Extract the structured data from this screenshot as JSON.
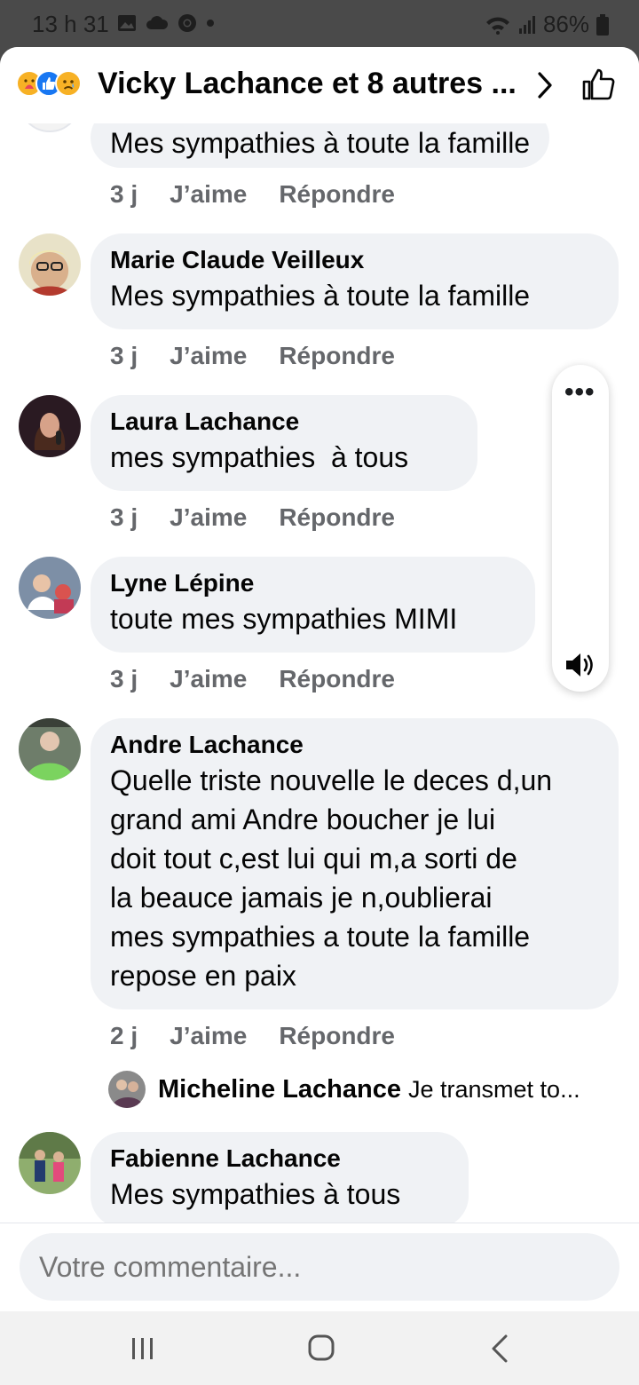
{
  "status_bar": {
    "time": "13 h 31",
    "battery": "86%"
  },
  "header": {
    "title": "Vicky Lachance et 8 autres ...",
    "reaction_icons": [
      "care-reaction-icon",
      "like-reaction-icon",
      "sad-reaction-icon"
    ]
  },
  "comments": [
    {
      "author": "",
      "text": "Mes sympathies à toute la famille",
      "time": "3 j",
      "like": "J’aime",
      "reply": "Répondre"
    },
    {
      "author": "Marie Claude Veilleux",
      "text": "Mes sympathies à toute la famille",
      "time": "3 j",
      "like": "J’aime",
      "reply": "Répondre"
    },
    {
      "author": "Laura Lachance",
      "text": "mes sympathies  à tous",
      "time": "3 j",
      "like": "J’aime",
      "reply": "Répondre"
    },
    {
      "author": "Lyne Lépine",
      "text": "toute mes sympathies MIMI",
      "time": "3 j",
      "like": "J’aime",
      "reply": "Répondre"
    },
    {
      "author": "Andre Lachance",
      "text_lines": [
        "Quelle triste nouvelle le deces d,un",
        "grand ami Andre boucher je lui",
        "doit tout c,est lui qui m,a sorti de",
        "la beauce jamais je n,oublierai",
        "mes sympathies a toute la famille",
        "repose en paix"
      ],
      "time": "2 j",
      "like": "J’aime",
      "reply": "Répondre"
    },
    {
      "author": "Fabienne Lachance",
      "text": "Mes sympathies à tous"
    }
  ],
  "reply_preview": {
    "author": "Micheline Lachance",
    "text": "Je transmet to..."
  },
  "composer": {
    "placeholder": "Votre commentaire..."
  },
  "colors": {
    "bubble": "#f0f2f5",
    "meta_text": "#65676b",
    "primary_text": "#050505",
    "like_blue": "#1877f2"
  }
}
